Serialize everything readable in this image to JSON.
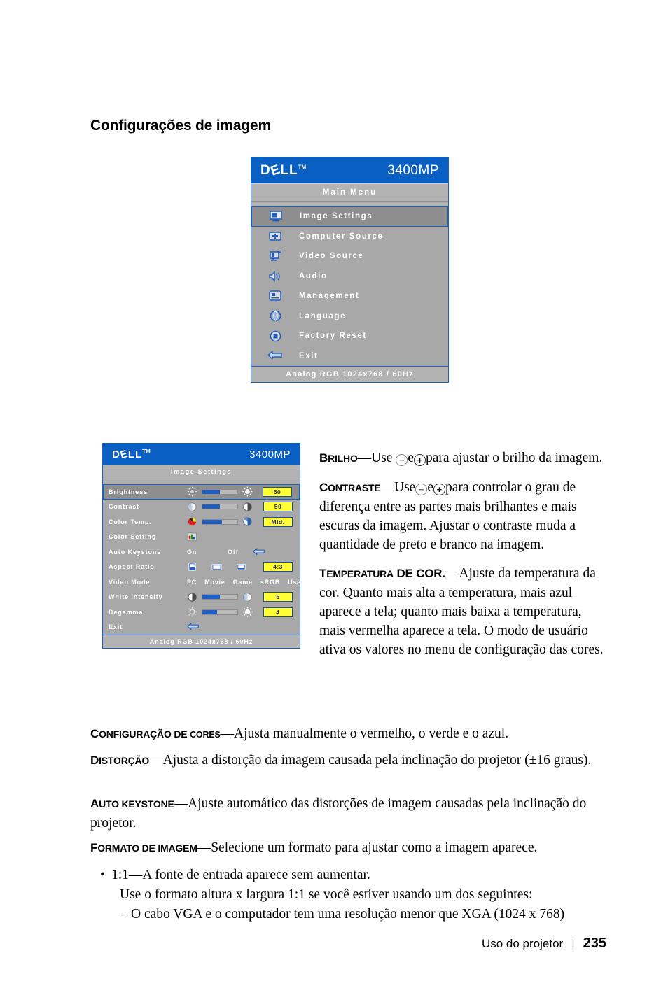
{
  "page": {
    "heading": "Configurações de imagem",
    "footer_text": "Uso do projetor",
    "footer_separator": "|",
    "page_number": "235"
  },
  "osd_main": {
    "brand": "DELL",
    "brand_tm": "TM",
    "model": "3400MP",
    "title": "Main Menu",
    "status": "Analog RGB 1024x768 / 60Hz",
    "items": [
      {
        "label": "Image Settings",
        "icon": "monitor-image-icon",
        "selected": true
      },
      {
        "label": "Computer Source",
        "icon": "computer-source-icon",
        "selected": false
      },
      {
        "label": "Video Source",
        "icon": "video-source-icon",
        "selected": false
      },
      {
        "label": "Audio",
        "icon": "speaker-icon",
        "selected": false
      },
      {
        "label": "Management",
        "icon": "management-icon",
        "selected": false
      },
      {
        "label": "Language",
        "icon": "globe-icon",
        "selected": false
      },
      {
        "label": "Factory Reset",
        "icon": "reset-icon",
        "selected": false
      },
      {
        "label": "Exit",
        "icon": "back-arrow-icon",
        "selected": false
      }
    ]
  },
  "osd_image": {
    "brand": "DELL",
    "brand_tm": "TM",
    "model": "3400MP",
    "title": "Image Settings",
    "status": "Analog RGB 1024x768 / 60Hz",
    "rows": [
      {
        "label": "Brightness",
        "type": "slider",
        "fill_pct": 50,
        "value": "50",
        "selected": true
      },
      {
        "label": "Contrast",
        "type": "slider",
        "fill_pct": 50,
        "value": "50",
        "selected": false
      },
      {
        "label": "Color Temp.",
        "type": "slider",
        "fill_pct": 55,
        "value": "Mid.",
        "selected": false
      },
      {
        "label": "Color Setting",
        "type": "icon-only",
        "selected": false
      },
      {
        "label": "Auto Keystone",
        "type": "onoff",
        "on_label": "On",
        "off_label": "Off",
        "selected": false
      },
      {
        "label": "Aspect Ratio",
        "type": "aspect",
        "value": "4:3",
        "selected": false
      },
      {
        "label": "Video Mode",
        "type": "modes",
        "modes": [
          "PC",
          "Movie",
          "Game",
          "sRGB",
          "User"
        ],
        "selected": false
      },
      {
        "label": "White Intensity",
        "type": "slider",
        "fill_pct": 50,
        "value": "5",
        "selected": false
      },
      {
        "label": "Degamma",
        "type": "slider",
        "fill_pct": 42,
        "value": "4",
        "selected": false
      },
      {
        "label": "Exit",
        "type": "exit",
        "selected": false
      }
    ]
  },
  "body": {
    "brilho": {
      "term": "B",
      "term_rest": "RILHO",
      "text_a": "—Use ",
      "text_b": "e",
      "text_c": "para ajustar o brilho da imagem."
    },
    "contraste": {
      "term": "C",
      "term_rest": "ONTRASTE",
      "text_a": "—Use",
      "text_b": "e",
      "text_c": "para controlar o grau de diferença entre as partes mais brilhantes e mais escuras da imagem. Ajustar o contraste muda a quantidade de preto e branco na imagem."
    },
    "temperatura": {
      "term": "T",
      "term_rest": "EMPERATURA",
      "term_rest2": " DE ",
      "term_rest3": "COR.",
      "text": "—Ajuste da temperatura da cor. Quanto mais alta a temperatura, mais azul aparece a tela; quanto mais baixa a temperatura, mais vermelha aparece a tela. O modo de usuário ativa os valores no menu de configuração das cores."
    },
    "config_cores": {
      "term": "C",
      "term_rest": "ONFIGURAÇÃO DE ",
      "term_small": "CORES",
      "text": "—Ajusta manualmente o vermelho, o verde e o azul."
    },
    "distorcao": {
      "term": "D",
      "term_rest": "ISTORÇÃO",
      "text": "—Ajusta a distorção da imagem causada pela inclinação do projetor (±16 graus)."
    },
    "auto_keystone": {
      "term": "A",
      "term_rest": "UTO KEYSTONE",
      "text": "—Ajuste automático das distorções de imagem causadas pela inclinação do projetor."
    },
    "formato": {
      "term": "F",
      "term_rest": "ORMATO DE IMAGEM",
      "text": "—Selecione um formato para ajustar como a imagem aparece."
    },
    "bullets": [
      {
        "marker": "•",
        "text": "1:1—A fonte de entrada aparece sem aumentar."
      },
      {
        "marker": "",
        "text": "Use o formato altura x largura 1:1 se você estiver usando um dos seguintes:"
      },
      {
        "marker": "–",
        "text": "O cabo VGA e o computador tem uma resolução menor que XGA (1024 x 768)"
      }
    ]
  },
  "colors": {
    "osd_header_blue": "#0a5fc2",
    "osd_body_gray": "#a8a8a8",
    "osd_bar_gray": "#b3b3b3",
    "osd_selected_gray": "#8e8e8e",
    "osd_border_blue": "#1464c8",
    "value_box_yellow": "#ffff33",
    "slider_fill_blue": "#1f5fc4"
  }
}
